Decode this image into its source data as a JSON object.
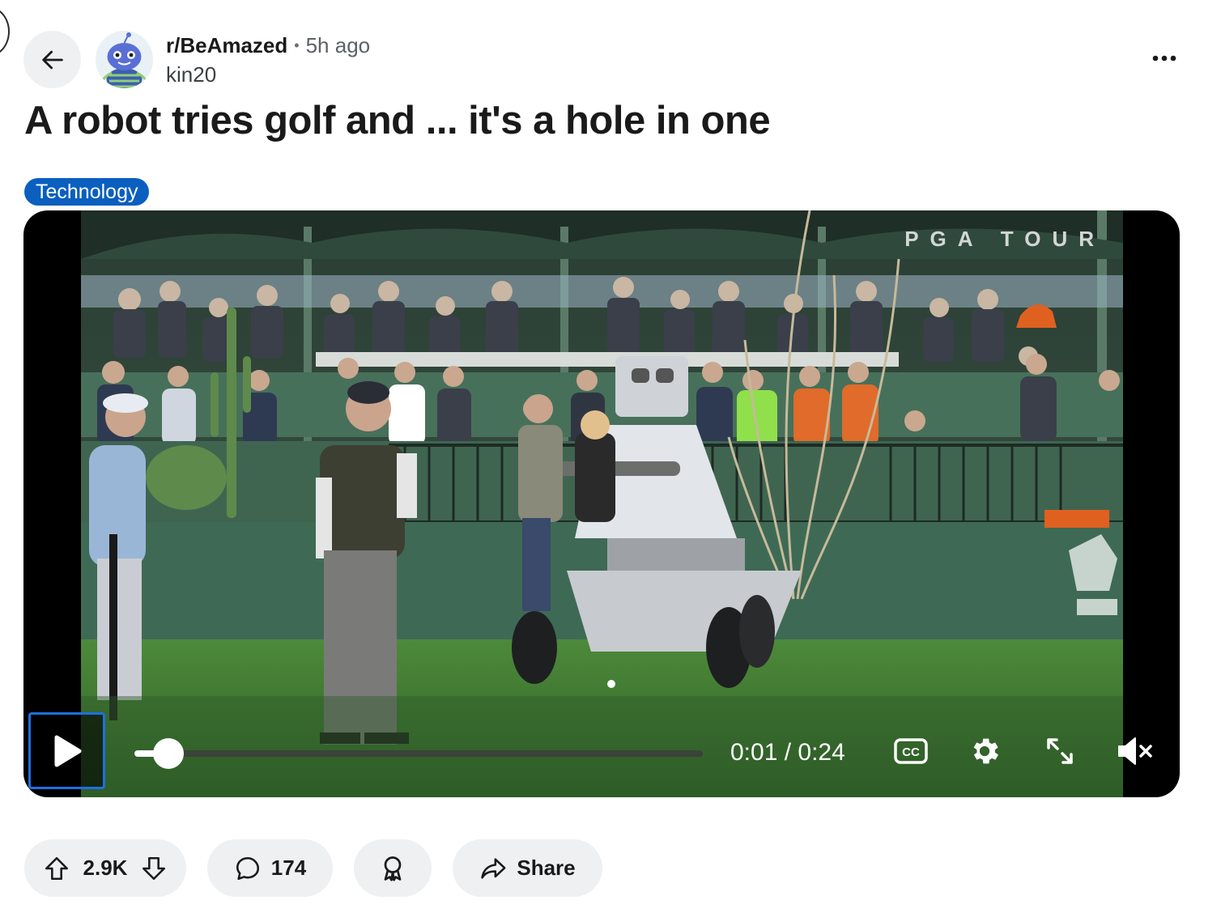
{
  "post": {
    "subreddit": "r/BeAmazed",
    "separator": "•",
    "time_ago": "5h ago",
    "author": "kin20",
    "title": "A robot tries golf and ... it's a hole in one",
    "flair": "Technology"
  },
  "video": {
    "watermark": "PGA TOUR",
    "current_time": "0:01",
    "duration": "0:24",
    "time_display": "0:01 / 0:24",
    "progress_fraction": 0.06,
    "muted": true,
    "playing": false,
    "cc_label": "CC"
  },
  "actions": {
    "score": "2.9K",
    "comments": "174",
    "share_label": "Share"
  },
  "icons": {
    "back": "arrow-left-icon",
    "more": "more-horizontal-icon",
    "play": "play-icon",
    "cc": "closed-captions-icon",
    "settings": "gear-icon",
    "fullscreen": "expand-icon",
    "mute": "volume-muted-icon",
    "upvote": "arrow-up-icon",
    "downvote": "arrow-down-icon",
    "comment": "comment-bubble-icon",
    "award": "award-ribbon-icon",
    "share": "share-arrow-icon"
  },
  "colors": {
    "flair_bg": "#0a5fbf",
    "focus_ring": "#1f6fe0",
    "pill_bg": "#eef0f2"
  }
}
